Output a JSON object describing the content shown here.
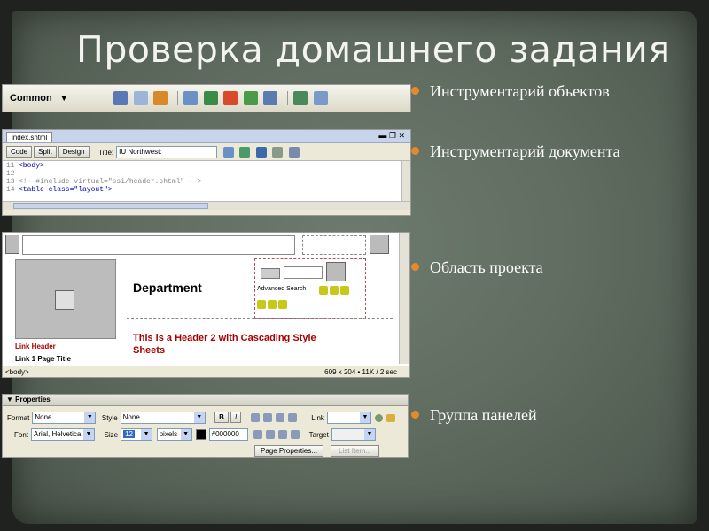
{
  "title": "Проверка домашнего задания",
  "bullets": [
    "Инструментарий объектов",
    "Инструментарий документа",
    "Область проекта",
    "Группа панелей"
  ],
  "insert_bar": {
    "category": "Common"
  },
  "doc_toolbar": {
    "tab": "index.shtml",
    "code": "Code",
    "split": "Split",
    "design": "Design",
    "title_label": "Title:",
    "title_value": "IU Northwest:",
    "lines": [
      {
        "num": "11",
        "text": "<body>"
      },
      {
        "num": "12",
        "text": ""
      },
      {
        "num": "13",
        "text": "<!--#include virtual=\"ssi/header.shtml\" -->"
      },
      {
        "num": "14",
        "text": "<table class=\"layout\">"
      }
    ]
  },
  "design": {
    "department": "Department",
    "advanced_search": "Advanced Search",
    "header2": "This is a Header 2 with Cascading Style Sheets",
    "link_header": "Link Header",
    "link_page": "Link 1 Page Title",
    "body_tag": "<body>",
    "status": "609 x 204 • 11K / 2 sec"
  },
  "properties": {
    "title": "Properties",
    "format_label": "Format",
    "format_value": "None",
    "style_label": "Style",
    "style_value": "None",
    "bold": "B",
    "italic": "I",
    "link_label": "Link",
    "font_label": "Font",
    "font_value": "Arial, Helvetica",
    "size_label": "Size",
    "size_value": "12",
    "units_value": "pixels",
    "color_value": "#000000",
    "target_label": "Target",
    "page_properties": "Page Properties...",
    "list_item": "List Item..."
  },
  "colors": {
    "bullet": "#e48a2c",
    "title": "#f3f3ef",
    "header2": "#a80000"
  }
}
